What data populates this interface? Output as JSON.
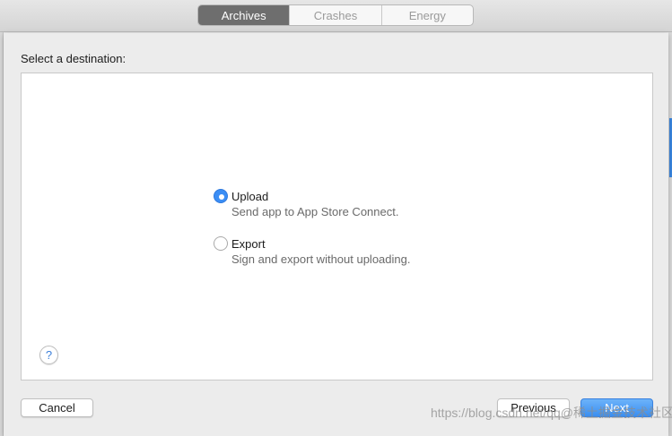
{
  "toolbar": {
    "tabs": [
      {
        "label": "Archives",
        "active": true
      },
      {
        "label": "Crashes",
        "active": false
      },
      {
        "label": "Energy",
        "active": false
      }
    ]
  },
  "sheet": {
    "heading": "Select a destination:",
    "options": [
      {
        "label": "Upload",
        "description": "Send app to App Store Connect.",
        "selected": true
      },
      {
        "label": "Export",
        "description": "Sign and export without uploading.",
        "selected": false
      }
    ],
    "help_glyph": "?",
    "buttons": {
      "cancel": "Cancel",
      "previous": "Previous",
      "next": "Next"
    }
  },
  "watermark": "https://blog.csdn.net/qq@稀土掘金技术社区",
  "colors": {
    "accent": "#3b8ef5",
    "active_tab": "#6e6e6e"
  },
  "icons": {
    "help": "help-icon",
    "radio": "radio-icon"
  }
}
